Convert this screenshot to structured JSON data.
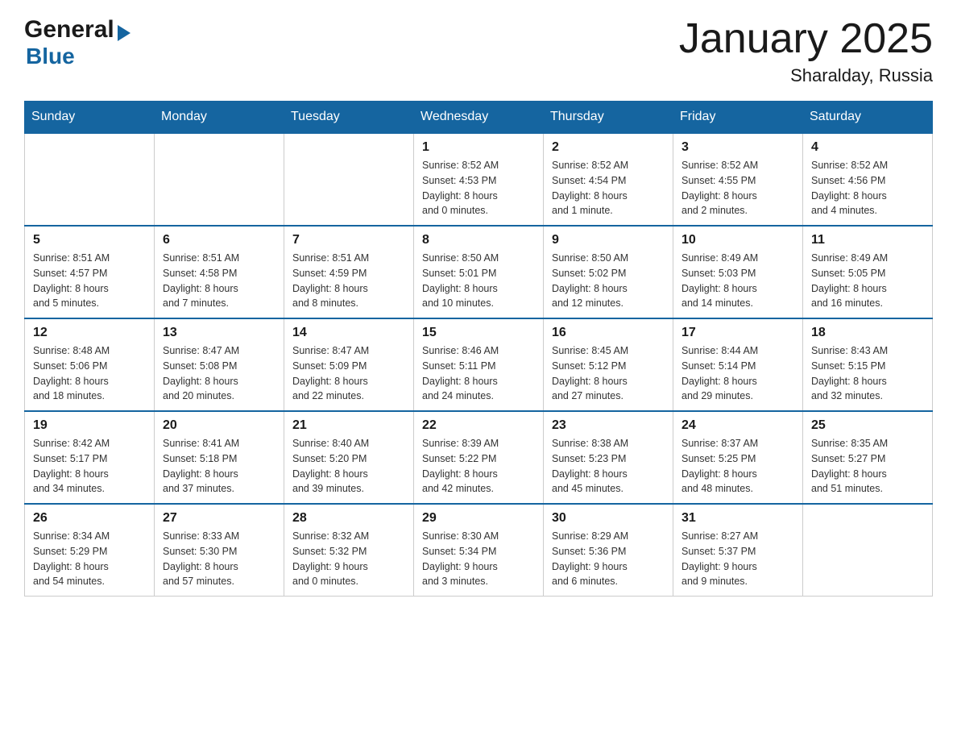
{
  "logo": {
    "general": "General",
    "arrow": "▶",
    "blue": "Blue"
  },
  "title": "January 2025",
  "location": "Sharalday, Russia",
  "days_of_week": [
    "Sunday",
    "Monday",
    "Tuesday",
    "Wednesday",
    "Thursday",
    "Friday",
    "Saturday"
  ],
  "weeks": [
    [
      {
        "day": "",
        "info": ""
      },
      {
        "day": "",
        "info": ""
      },
      {
        "day": "",
        "info": ""
      },
      {
        "day": "1",
        "info": "Sunrise: 8:52 AM\nSunset: 4:53 PM\nDaylight: 8 hours\nand 0 minutes."
      },
      {
        "day": "2",
        "info": "Sunrise: 8:52 AM\nSunset: 4:54 PM\nDaylight: 8 hours\nand 1 minute."
      },
      {
        "day": "3",
        "info": "Sunrise: 8:52 AM\nSunset: 4:55 PM\nDaylight: 8 hours\nand 2 minutes."
      },
      {
        "day": "4",
        "info": "Sunrise: 8:52 AM\nSunset: 4:56 PM\nDaylight: 8 hours\nand 4 minutes."
      }
    ],
    [
      {
        "day": "5",
        "info": "Sunrise: 8:51 AM\nSunset: 4:57 PM\nDaylight: 8 hours\nand 5 minutes."
      },
      {
        "day": "6",
        "info": "Sunrise: 8:51 AM\nSunset: 4:58 PM\nDaylight: 8 hours\nand 7 minutes."
      },
      {
        "day": "7",
        "info": "Sunrise: 8:51 AM\nSunset: 4:59 PM\nDaylight: 8 hours\nand 8 minutes."
      },
      {
        "day": "8",
        "info": "Sunrise: 8:50 AM\nSunset: 5:01 PM\nDaylight: 8 hours\nand 10 minutes."
      },
      {
        "day": "9",
        "info": "Sunrise: 8:50 AM\nSunset: 5:02 PM\nDaylight: 8 hours\nand 12 minutes."
      },
      {
        "day": "10",
        "info": "Sunrise: 8:49 AM\nSunset: 5:03 PM\nDaylight: 8 hours\nand 14 minutes."
      },
      {
        "day": "11",
        "info": "Sunrise: 8:49 AM\nSunset: 5:05 PM\nDaylight: 8 hours\nand 16 minutes."
      }
    ],
    [
      {
        "day": "12",
        "info": "Sunrise: 8:48 AM\nSunset: 5:06 PM\nDaylight: 8 hours\nand 18 minutes."
      },
      {
        "day": "13",
        "info": "Sunrise: 8:47 AM\nSunset: 5:08 PM\nDaylight: 8 hours\nand 20 minutes."
      },
      {
        "day": "14",
        "info": "Sunrise: 8:47 AM\nSunset: 5:09 PM\nDaylight: 8 hours\nand 22 minutes."
      },
      {
        "day": "15",
        "info": "Sunrise: 8:46 AM\nSunset: 5:11 PM\nDaylight: 8 hours\nand 24 minutes."
      },
      {
        "day": "16",
        "info": "Sunrise: 8:45 AM\nSunset: 5:12 PM\nDaylight: 8 hours\nand 27 minutes."
      },
      {
        "day": "17",
        "info": "Sunrise: 8:44 AM\nSunset: 5:14 PM\nDaylight: 8 hours\nand 29 minutes."
      },
      {
        "day": "18",
        "info": "Sunrise: 8:43 AM\nSunset: 5:15 PM\nDaylight: 8 hours\nand 32 minutes."
      }
    ],
    [
      {
        "day": "19",
        "info": "Sunrise: 8:42 AM\nSunset: 5:17 PM\nDaylight: 8 hours\nand 34 minutes."
      },
      {
        "day": "20",
        "info": "Sunrise: 8:41 AM\nSunset: 5:18 PM\nDaylight: 8 hours\nand 37 minutes."
      },
      {
        "day": "21",
        "info": "Sunrise: 8:40 AM\nSunset: 5:20 PM\nDaylight: 8 hours\nand 39 minutes."
      },
      {
        "day": "22",
        "info": "Sunrise: 8:39 AM\nSunset: 5:22 PM\nDaylight: 8 hours\nand 42 minutes."
      },
      {
        "day": "23",
        "info": "Sunrise: 8:38 AM\nSunset: 5:23 PM\nDaylight: 8 hours\nand 45 minutes."
      },
      {
        "day": "24",
        "info": "Sunrise: 8:37 AM\nSunset: 5:25 PM\nDaylight: 8 hours\nand 48 minutes."
      },
      {
        "day": "25",
        "info": "Sunrise: 8:35 AM\nSunset: 5:27 PM\nDaylight: 8 hours\nand 51 minutes."
      }
    ],
    [
      {
        "day": "26",
        "info": "Sunrise: 8:34 AM\nSunset: 5:29 PM\nDaylight: 8 hours\nand 54 minutes."
      },
      {
        "day": "27",
        "info": "Sunrise: 8:33 AM\nSunset: 5:30 PM\nDaylight: 8 hours\nand 57 minutes."
      },
      {
        "day": "28",
        "info": "Sunrise: 8:32 AM\nSunset: 5:32 PM\nDaylight: 9 hours\nand 0 minutes."
      },
      {
        "day": "29",
        "info": "Sunrise: 8:30 AM\nSunset: 5:34 PM\nDaylight: 9 hours\nand 3 minutes."
      },
      {
        "day": "30",
        "info": "Sunrise: 8:29 AM\nSunset: 5:36 PM\nDaylight: 9 hours\nand 6 minutes."
      },
      {
        "day": "31",
        "info": "Sunrise: 8:27 AM\nSunset: 5:37 PM\nDaylight: 9 hours\nand 9 minutes."
      },
      {
        "day": "",
        "info": ""
      }
    ]
  ]
}
